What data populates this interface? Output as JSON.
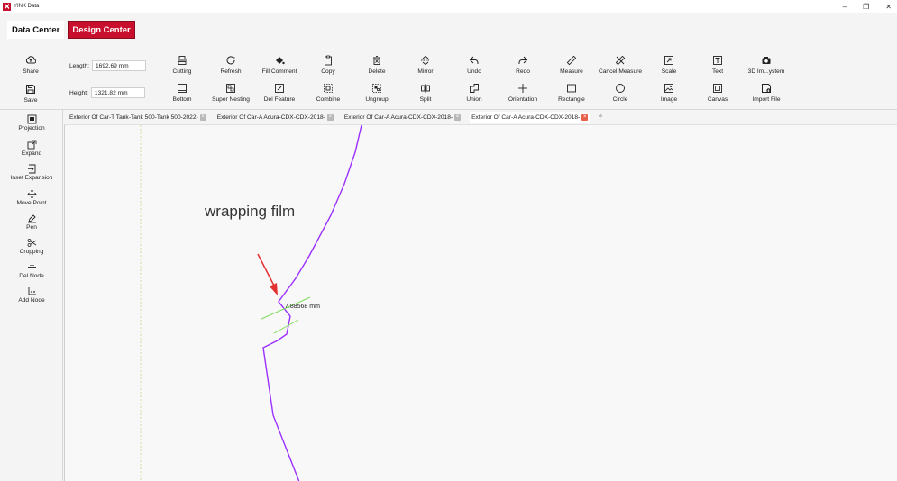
{
  "window": {
    "title": "YINK Data",
    "controls": [
      "–",
      "❐",
      "✕"
    ]
  },
  "nav": {
    "data_center": "Data Center",
    "design_center": "Design Center"
  },
  "toolbar": {
    "share": "Share",
    "save": "Save",
    "length_label": "Length:",
    "length_value": "1692.69 mm",
    "height_label": "Height:",
    "height_value": "1321.82 mm",
    "row1": [
      "Cutting",
      "Refresh",
      "Fill Comment",
      "Copy",
      "Delete",
      "Mirror",
      "Undo",
      "Redo",
      "Measure",
      "Cancel Measure",
      "Scale",
      "Text",
      "3D Im...ystem"
    ],
    "row2": [
      "Bottom",
      "Super Nesting",
      "Del Feature",
      "Combine",
      "Ungroup",
      "Split",
      "Union",
      "Orientation",
      "Rectangle",
      "Circle",
      "Image",
      "Canvas",
      "Import File"
    ]
  },
  "sidebar": [
    "Projection",
    "Expand",
    "Inset Expansion",
    "Move Point",
    "Pen",
    "Cropping",
    "Del Node",
    "Add Node"
  ],
  "tabs": [
    {
      "label": "Exterior Of Car-T Tank-Tank 500-Tank 500-2022-",
      "active": false
    },
    {
      "label": "Exterior Of Car-A Acura-CDX-CDX-2018-",
      "active": false
    },
    {
      "label": "Exterior Of Car-A Acura-CDX-CDX-2018-",
      "active": false
    },
    {
      "label": "Exterior Of Car-A Acura-CDX-CDX-2018-",
      "active": true
    }
  ],
  "canvas": {
    "annotation": "wrapping film",
    "measure_value": "7.88568 mm"
  },
  "colors": {
    "accent": "#c8102e",
    "path": "#9b30ff",
    "guide": "#7ddc5c",
    "arrow": "#e53030"
  }
}
